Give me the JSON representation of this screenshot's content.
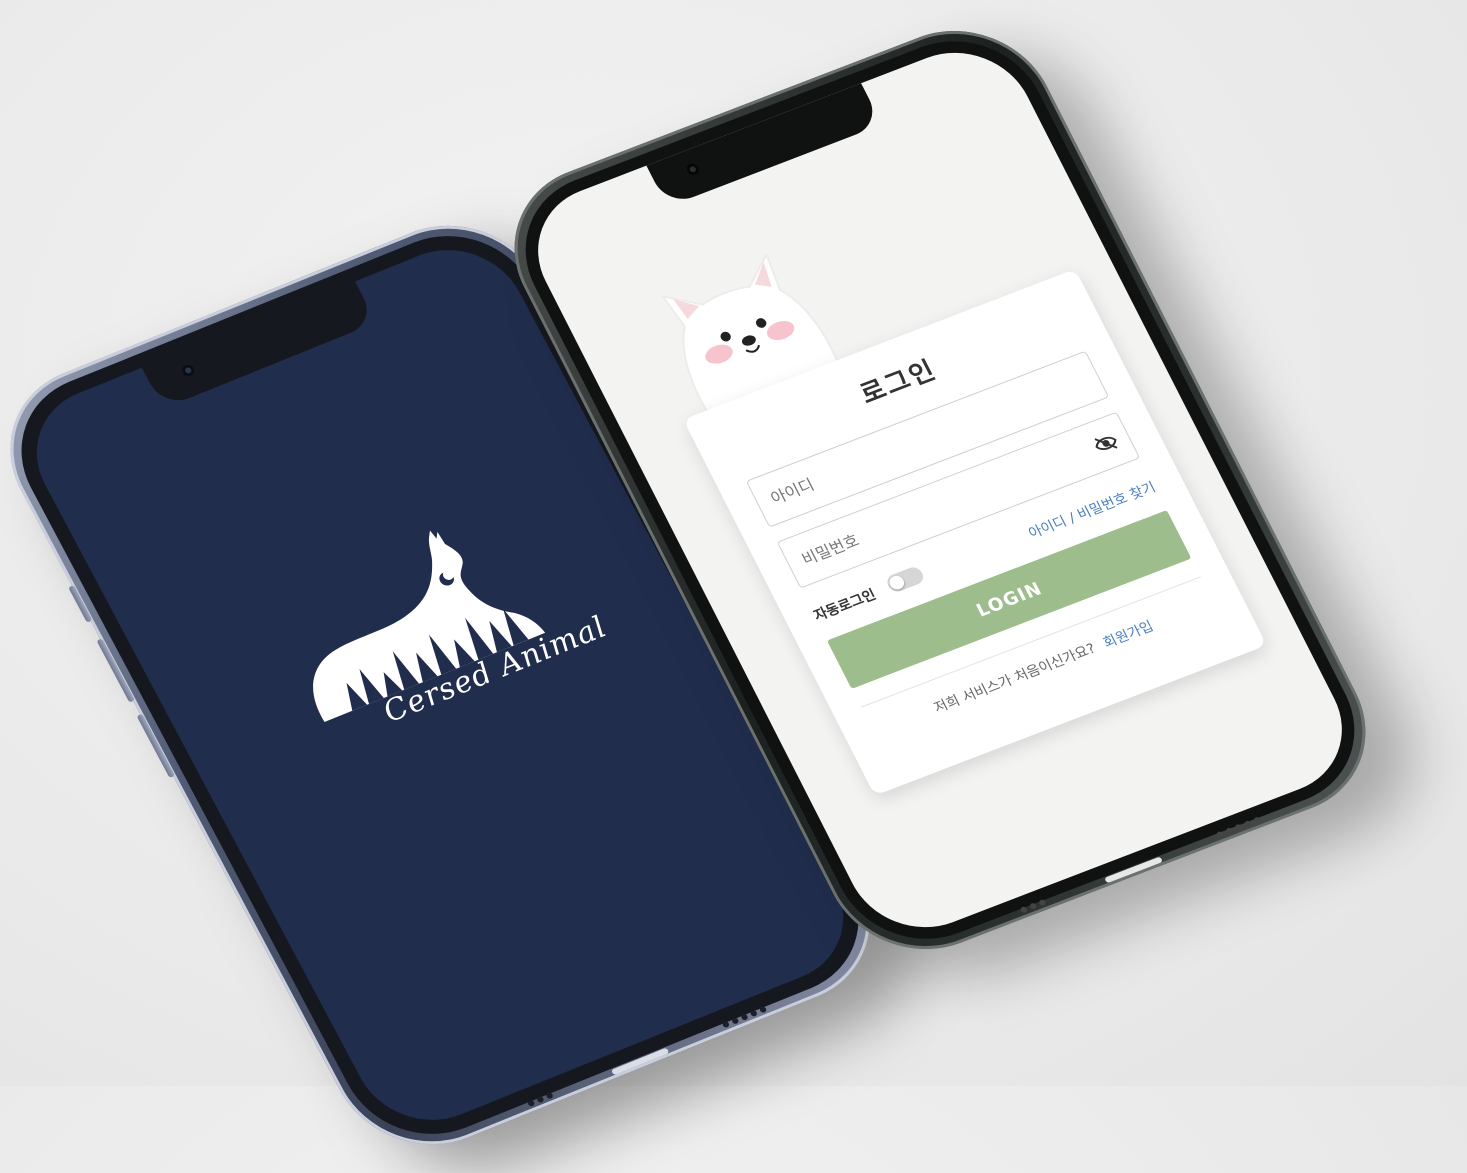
{
  "splash_screen": {
    "brand_name": "Cersed Animal",
    "background_color": "#212d4d",
    "logo_icon": "howling-wolf-forest-silhouette-icon"
  },
  "login_screen": {
    "title": "로그인",
    "id_placeholder": "아이디",
    "password_placeholder": "비밀번호",
    "password_visibility_icon": "eye-slash-icon",
    "auto_login_label": "자동로그인",
    "auto_login_enabled": false,
    "find_account_link": "아이디 / 비밀번호 찾기",
    "login_button": "LOGIN",
    "login_button_color": "#9dbd8c",
    "signup_prompt": "저희 서비스가 처음이신가요?",
    "signup_link": "회원가입",
    "link_color": "#4a7fc1",
    "mascot_icon": "samoyed-dog-icon"
  }
}
